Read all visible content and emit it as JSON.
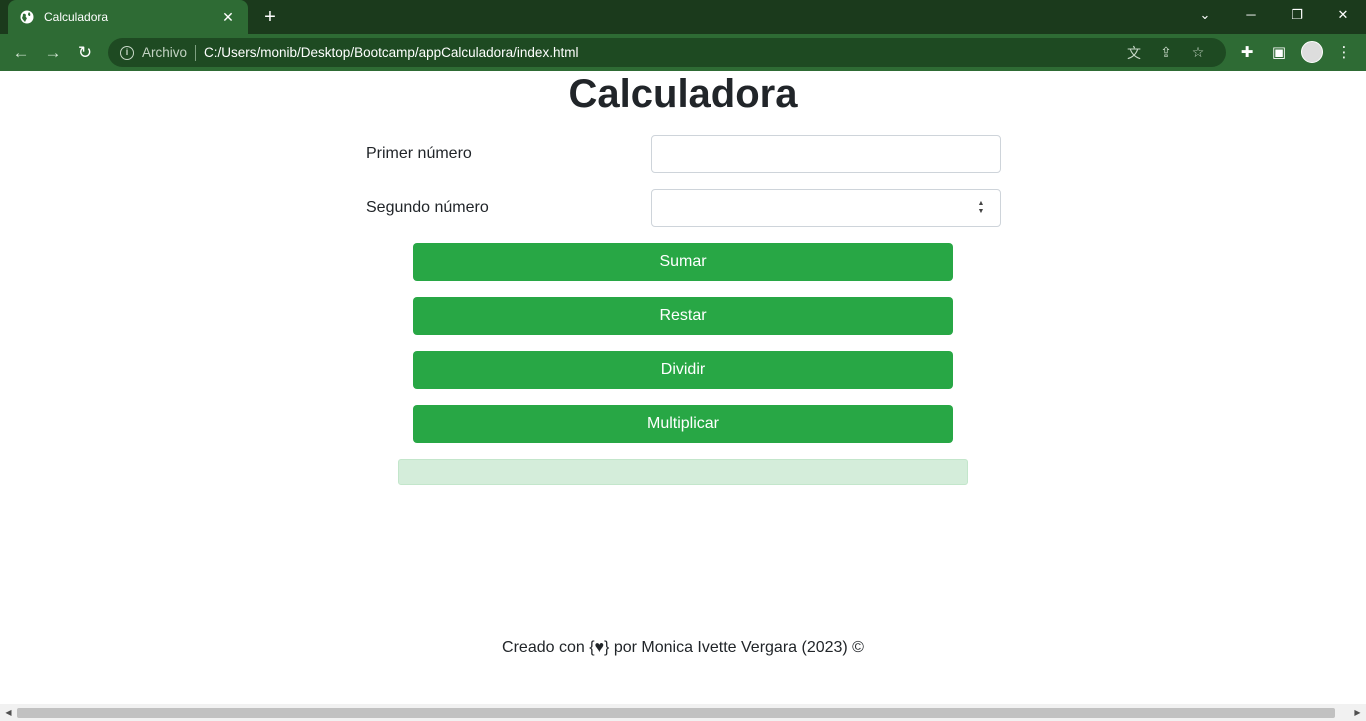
{
  "browser": {
    "tab_title": "Calculadora",
    "url_scheme": "Archivo",
    "url": "C:/Users/monib/Desktop/Bootcamp/appCalculadora/index.html",
    "accent_color": "#2e6b34"
  },
  "page": {
    "title": "Calculadora",
    "fields": {
      "first_label": "Primer número",
      "first_value": "",
      "second_label": "Segundo número",
      "second_value": ""
    },
    "buttons": {
      "add": "Sumar",
      "subtract": "Restar",
      "divide": "Dividir",
      "multiply": "Multiplicar",
      "color": "#28a745"
    },
    "result": "",
    "footer": "Creado con {♥} por Monica Ivette Vergara (2023) ©"
  }
}
